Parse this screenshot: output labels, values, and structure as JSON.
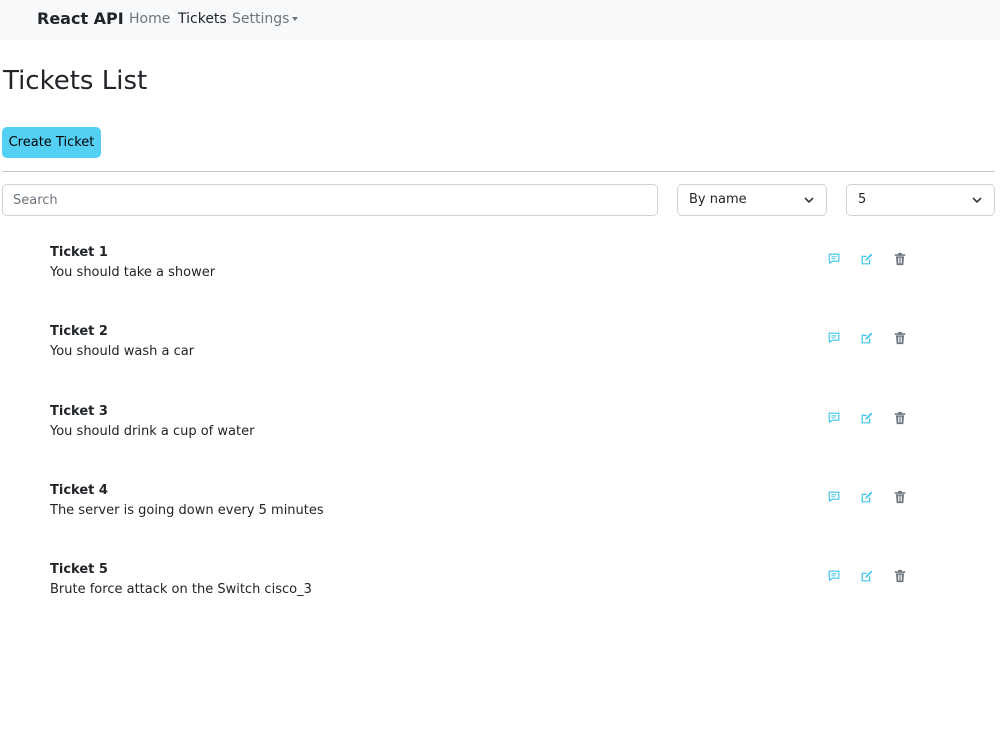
{
  "navbar": {
    "brand": "React API",
    "links": [
      {
        "label": "Home"
      },
      {
        "label": "Tickets"
      },
      {
        "label": "Settings"
      }
    ]
  },
  "page": {
    "title": "Tickets List",
    "create_button": "Create Ticket"
  },
  "filters": {
    "search_placeholder": "Search",
    "search_value": "",
    "sort_selected": "By name",
    "page_size_selected": "5"
  },
  "tickets": [
    {
      "title": "Ticket 1",
      "description": "You should take a shower"
    },
    {
      "title": "Ticket 2",
      "description": "You should wash a car"
    },
    {
      "title": "Ticket 3",
      "description": "You should drink a cup of water"
    },
    {
      "title": "Ticket 4",
      "description": "The server is going down every 5 minutes"
    },
    {
      "title": "Ticket 5",
      "description": "Brute force attack on the Switch cisco_3"
    }
  ],
  "icons": {
    "comment": "comment-icon",
    "edit": "edit-icon",
    "delete": "trash-icon"
  },
  "colors": {
    "accent": "#55d0f5",
    "icon_action": "#3dc5ee",
    "icon_delete": "#6c757d",
    "navbar_bg": "#f8f9fa"
  }
}
